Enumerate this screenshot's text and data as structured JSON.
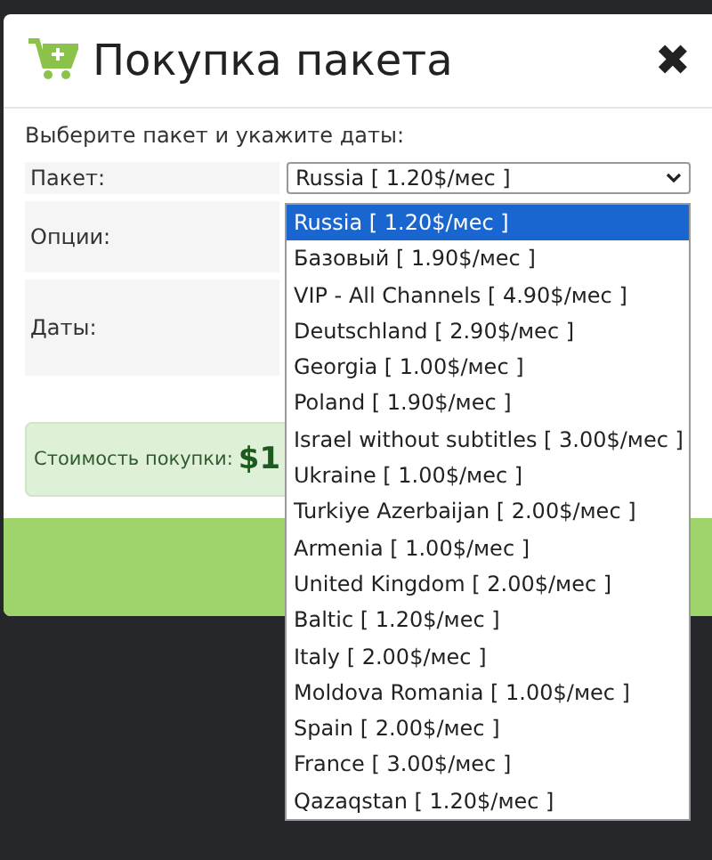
{
  "modal": {
    "title": "Покупка пакета",
    "close": "✖",
    "intro": "Выберите пакет и укажите даты:",
    "fields": [
      {
        "label": "Пакет:",
        "kind": "select",
        "value": "Russia [ 1.20$/мес ]"
      },
      {
        "label": "Опции:",
        "kind": "empty"
      },
      {
        "label": "Даты:",
        "kind": "empty"
      }
    ],
    "cost": {
      "label": "Стоимость покупки:",
      "value": "$1"
    },
    "dropdown": [
      {
        "label": "Russia [ 1.20$/мес ]",
        "selected": true
      },
      {
        "label": "Базовый [ 1.90$/мес ]",
        "selected": false
      },
      {
        "label": "VIP - All Channels [ 4.90$/мес ]",
        "selected": false
      },
      {
        "label": "Deutschland [ 2.90$/мес ]",
        "selected": false
      },
      {
        "label": "Georgia [ 1.00$/мес ]",
        "selected": false
      },
      {
        "label": "Poland [ 1.90$/мес ]",
        "selected": false
      },
      {
        "label": "Israel without subtitles [ 3.00$/мес ]",
        "selected": false
      },
      {
        "label": "Ukraine [ 1.00$/мес ]",
        "selected": false
      },
      {
        "label": "Turkiye Azerbaijan [ 2.00$/мес ]",
        "selected": false
      },
      {
        "label": "Armenia [ 1.00$/мес ]",
        "selected": false
      },
      {
        "label": "United Kingdom [ 2.00$/мес ]",
        "selected": false
      },
      {
        "label": "Baltic [ 1.20$/мес ]",
        "selected": false
      },
      {
        "label": "Italy [ 2.00$/мес ]",
        "selected": false
      },
      {
        "label": "Moldova Romania [ 1.00$/мес ]",
        "selected": false
      },
      {
        "label": "Spain [ 2.00$/мес ]",
        "selected": false
      },
      {
        "label": "France [ 3.00$/мес ]",
        "selected": false
      },
      {
        "label": "Qazaqstan [ 1.20$/мес ]",
        "selected": false
      }
    ]
  }
}
